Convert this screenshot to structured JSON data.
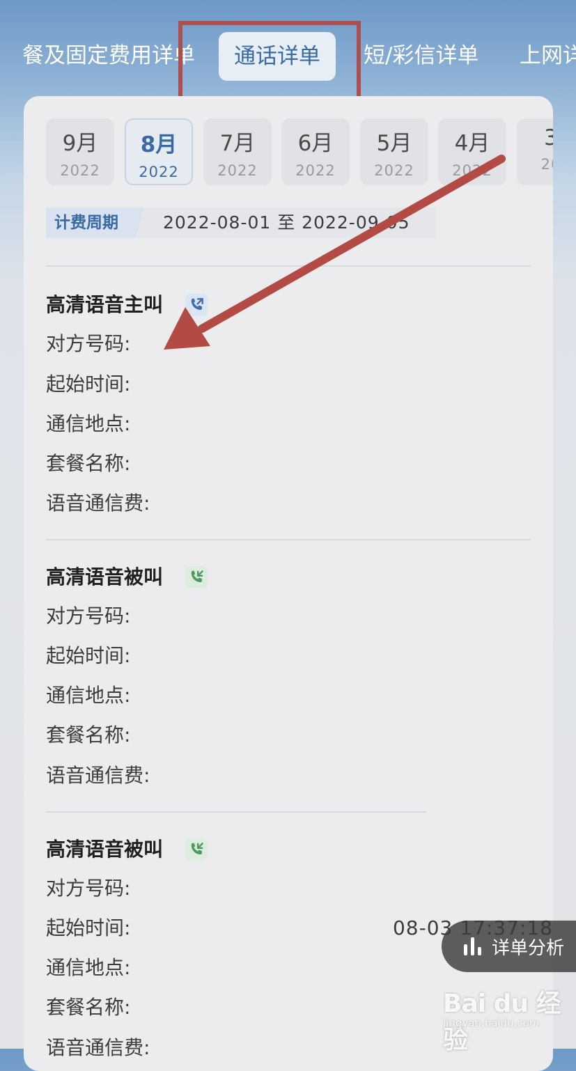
{
  "tabs": [
    {
      "label": "餐及固定费用详单"
    },
    {
      "label": "通话详单"
    },
    {
      "label": "短/彩信详单"
    },
    {
      "label": "上网详"
    }
  ],
  "months": [
    {
      "month": "9月",
      "year": "2022"
    },
    {
      "month": "8月",
      "year": "2022"
    },
    {
      "month": "7月",
      "year": "2022"
    },
    {
      "month": "6月",
      "year": "2022"
    },
    {
      "month": "5月",
      "year": "2022"
    },
    {
      "month": "4月",
      "year": "2022"
    },
    {
      "month": "3",
      "year": "20"
    }
  ],
  "billing": {
    "tag": "计费周期",
    "range": "2022-08-01  至  2022-09-05"
  },
  "records": [
    {
      "title": "高清语音主叫",
      "icon": "outgoing-call-icon",
      "fields": [
        "对方号码:",
        "起始时间:",
        "通信地点:",
        "套餐名称:",
        "语音通信费:"
      ],
      "start_time": ""
    },
    {
      "title": "高清语音被叫",
      "icon": "incoming-call-icon",
      "fields": [
        "对方号码:",
        "起始时间:",
        "通信地点:",
        "套餐名称:",
        "语音通信费:"
      ],
      "start_time": ""
    },
    {
      "title": "高清语音被叫",
      "icon": "incoming-call-icon",
      "fields": [
        "对方号码:",
        "起始时间:",
        "通信地点:",
        "套餐名称:",
        "语音通信费:"
      ],
      "start_time": "08-03 17:37:18"
    }
  ],
  "analysis_button": {
    "label": "详单分析"
  },
  "watermark": {
    "logo": "Bai du 经验",
    "url": "jingyan.baidu.com"
  },
  "colors": {
    "accent": "#3a6aa3",
    "highlight": "#ae4f4f",
    "arrow": "#b44a44"
  }
}
